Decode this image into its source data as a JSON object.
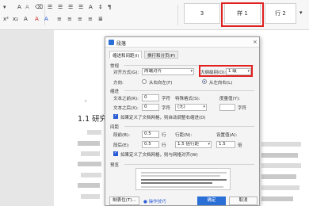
{
  "ribbon": {
    "row1": [
      "A",
      "A",
      "⌫",
      "☰",
      "☰",
      "☰",
      "☰",
      "A",
      "↕",
      "¶"
    ],
    "row2": [
      "x²",
      "x₂",
      "A",
      "A",
      "A",
      "≡",
      "≡",
      "≡",
      "≡",
      "≣"
    ],
    "styles": [
      {
        "label": "3"
      },
      {
        "label": "样 1"
      },
      {
        "label": "行 2"
      }
    ]
  },
  "document": {
    "heading": "1.1 研究背"
  },
  "dialog": {
    "title": "段落",
    "close": "×",
    "tabs": [
      "缩进和间距(I)",
      "换行和分页(P)"
    ],
    "general": {
      "section": "常规",
      "align_label": "对齐方式(G):",
      "align_value": "两端对齐",
      "outline_label": "大纲级别(O):",
      "outline_value": "1 级",
      "direction_label": "方向:",
      "rtl": "从右向左(F)",
      "ltr": "从左向右(L)"
    },
    "indent": {
      "section": "缩进",
      "before_label": "文本之前(R):",
      "before_value": "0",
      "before_unit": "字符",
      "special_label": "特殊格式(S):",
      "special_value": "(无)",
      "measure_label": "度量值(Y):",
      "measure_unit": "字符",
      "after_label": "文本之后(X):",
      "after_value": "0",
      "after_unit": "字符",
      "auto_adjust": "如果定义了文档网格，则自动调整右缩进(D)"
    },
    "spacing": {
      "section": "间距",
      "before_label": "段前(B):",
      "before_value": "0.5",
      "before_unit": "行",
      "line_label": "行距(N):",
      "line_value": "1.5 倍行距",
      "setvalue_label": "设置值(A):",
      "setvalue_value": "1.5",
      "setvalue_unit": "倍",
      "after_label": "段后(E):",
      "after_value": "0.5",
      "after_unit": "行",
      "snap_grid": "如果定义了文档网格，则与网格对齐(W)"
    },
    "preview_section": "预览",
    "buttons": {
      "tabs": "制表位(T)...",
      "tips": "操作技巧",
      "ok": "确定",
      "cancel": "取消"
    }
  }
}
